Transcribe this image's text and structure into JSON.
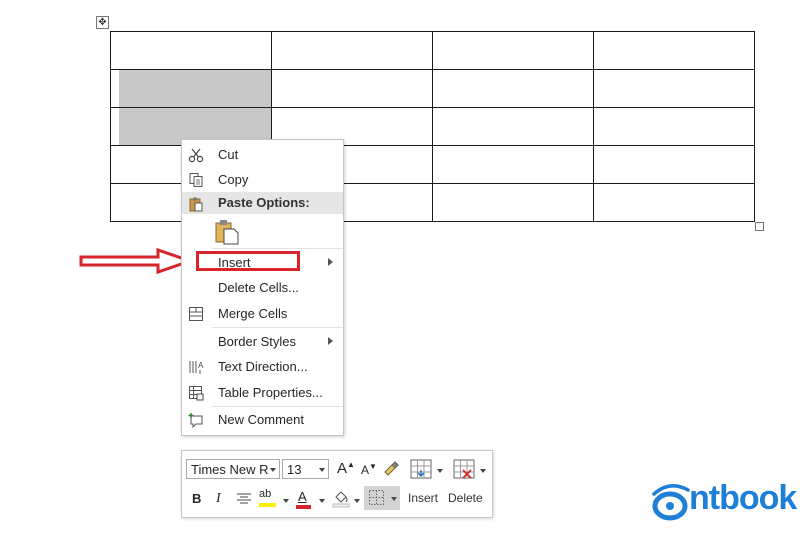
{
  "table": {
    "rows": 5,
    "cols": 4,
    "selected_cells": [
      [
        1,
        0
      ],
      [
        2,
        0
      ]
    ]
  },
  "context_menu": {
    "items": [
      {
        "label": "Cut",
        "icon": "scissors-icon"
      },
      {
        "label": "Copy",
        "icon": "copy-icon"
      },
      {
        "label": "Paste Options:",
        "icon": "paste-icon"
      },
      {
        "label": "Insert",
        "icon": "",
        "submenu": true,
        "highlighted": true
      },
      {
        "label": "Delete Cells...",
        "icon": ""
      },
      {
        "label": "Merge Cells",
        "icon": "merge-cells-icon"
      },
      {
        "label": "Border Styles",
        "icon": "",
        "submenu": true
      },
      {
        "label": "Text Direction...",
        "icon": "text-direction-icon"
      },
      {
        "label": "Table Properties...",
        "icon": "table-properties-icon"
      },
      {
        "label": "New Comment",
        "icon": "new-comment-icon"
      }
    ]
  },
  "mini_toolbar": {
    "font_name": "Times New Rc",
    "font_size": "13",
    "insert_label": "Insert",
    "delete_label": "Delete",
    "bold": "B",
    "italic": "I",
    "font_color_glyph": "A",
    "grow_font_glyph": "A",
    "shrink_font_glyph": "A",
    "highlight_glyph": "ab"
  },
  "logo": {
    "text": "ntbook",
    "color": "#1d7fd6"
  },
  "colors": {
    "annotation_red": "#d7262b",
    "selection_gray": "#c8c8c8"
  }
}
